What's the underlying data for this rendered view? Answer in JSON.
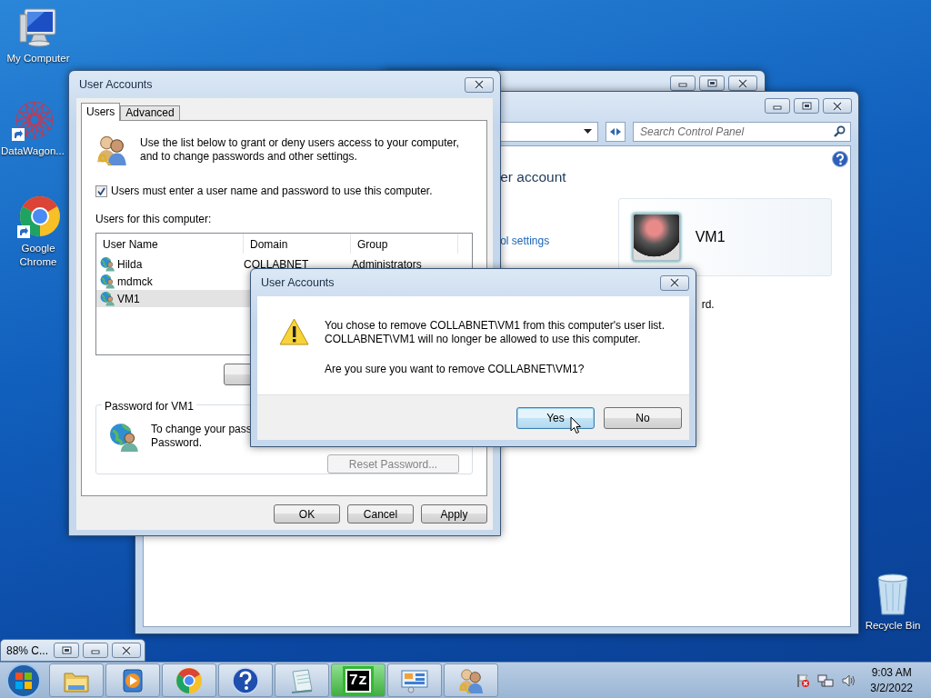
{
  "desktop_icons": [
    {
      "label": "My Computer",
      "kind": "computer"
    },
    {
      "label": "DataWagon...",
      "kind": "graph"
    },
    {
      "label": "Google Chrome",
      "kind": "browser"
    },
    {
      "label": "Recycle Bin",
      "kind": "bin"
    }
  ],
  "control_panel": {
    "search": {
      "placeholder": "Search Control Panel"
    },
    "heading": "er account",
    "link": "ol settings",
    "account": {
      "name": "VM1"
    },
    "note": "rd."
  },
  "user_accounts": {
    "title": "User Accounts",
    "tabs": [
      {
        "label": "Users",
        "selected": true
      },
      {
        "label": "Advanced",
        "selected": false
      }
    ],
    "intro_lines": [
      "Use the list below to grant or deny users access to your computer,",
      "and to change passwords and other settings."
    ],
    "require_login": {
      "label": "Users must enter a user name and password to use this computer.",
      "checked": true
    },
    "users_label": "Users for this computer:",
    "columns": [
      "User Name",
      "Domain",
      "Group"
    ],
    "rows": [
      {
        "user": "Hilda",
        "domain": "COLLABNET",
        "group": "Administrators",
        "selected": false
      },
      {
        "user": "mdmck",
        "selected": false
      },
      {
        "user": "VM1",
        "selected": true
      }
    ],
    "password_group": {
      "title": "Password for VM1",
      "text_lines": [
        "To change your pass",
        "Password."
      ],
      "reset_button": {
        "label": "Reset Password...",
        "disabled": true
      }
    },
    "buttons": [
      "OK",
      "Cancel",
      "Apply"
    ]
  },
  "confirm_dialog": {
    "title": "User Accounts",
    "lines": [
      "You chose to remove COLLABNET\\VM1 from this computer's user list.",
      "COLLABNET\\VM1 will no longer be allowed to use this computer."
    ],
    "question": "Are you sure you want to remove COLLABNET\\VM1?",
    "buttons": [
      {
        "label": "Yes",
        "focused": true
      },
      {
        "label": "No",
        "focused": false
      }
    ]
  },
  "minimized_window": {
    "title": "88% C..."
  },
  "taskbar": {
    "items": [
      {
        "kind": "folder"
      },
      {
        "kind": "media"
      },
      {
        "kind": "browser"
      },
      {
        "kind": "help"
      },
      {
        "kind": "notepad"
      },
      {
        "kind": "archive",
        "label": "7z"
      },
      {
        "kind": "panel"
      },
      {
        "kind": "users"
      }
    ],
    "clock": {
      "time": "9:03 AM",
      "date": "3/2/2022"
    }
  }
}
